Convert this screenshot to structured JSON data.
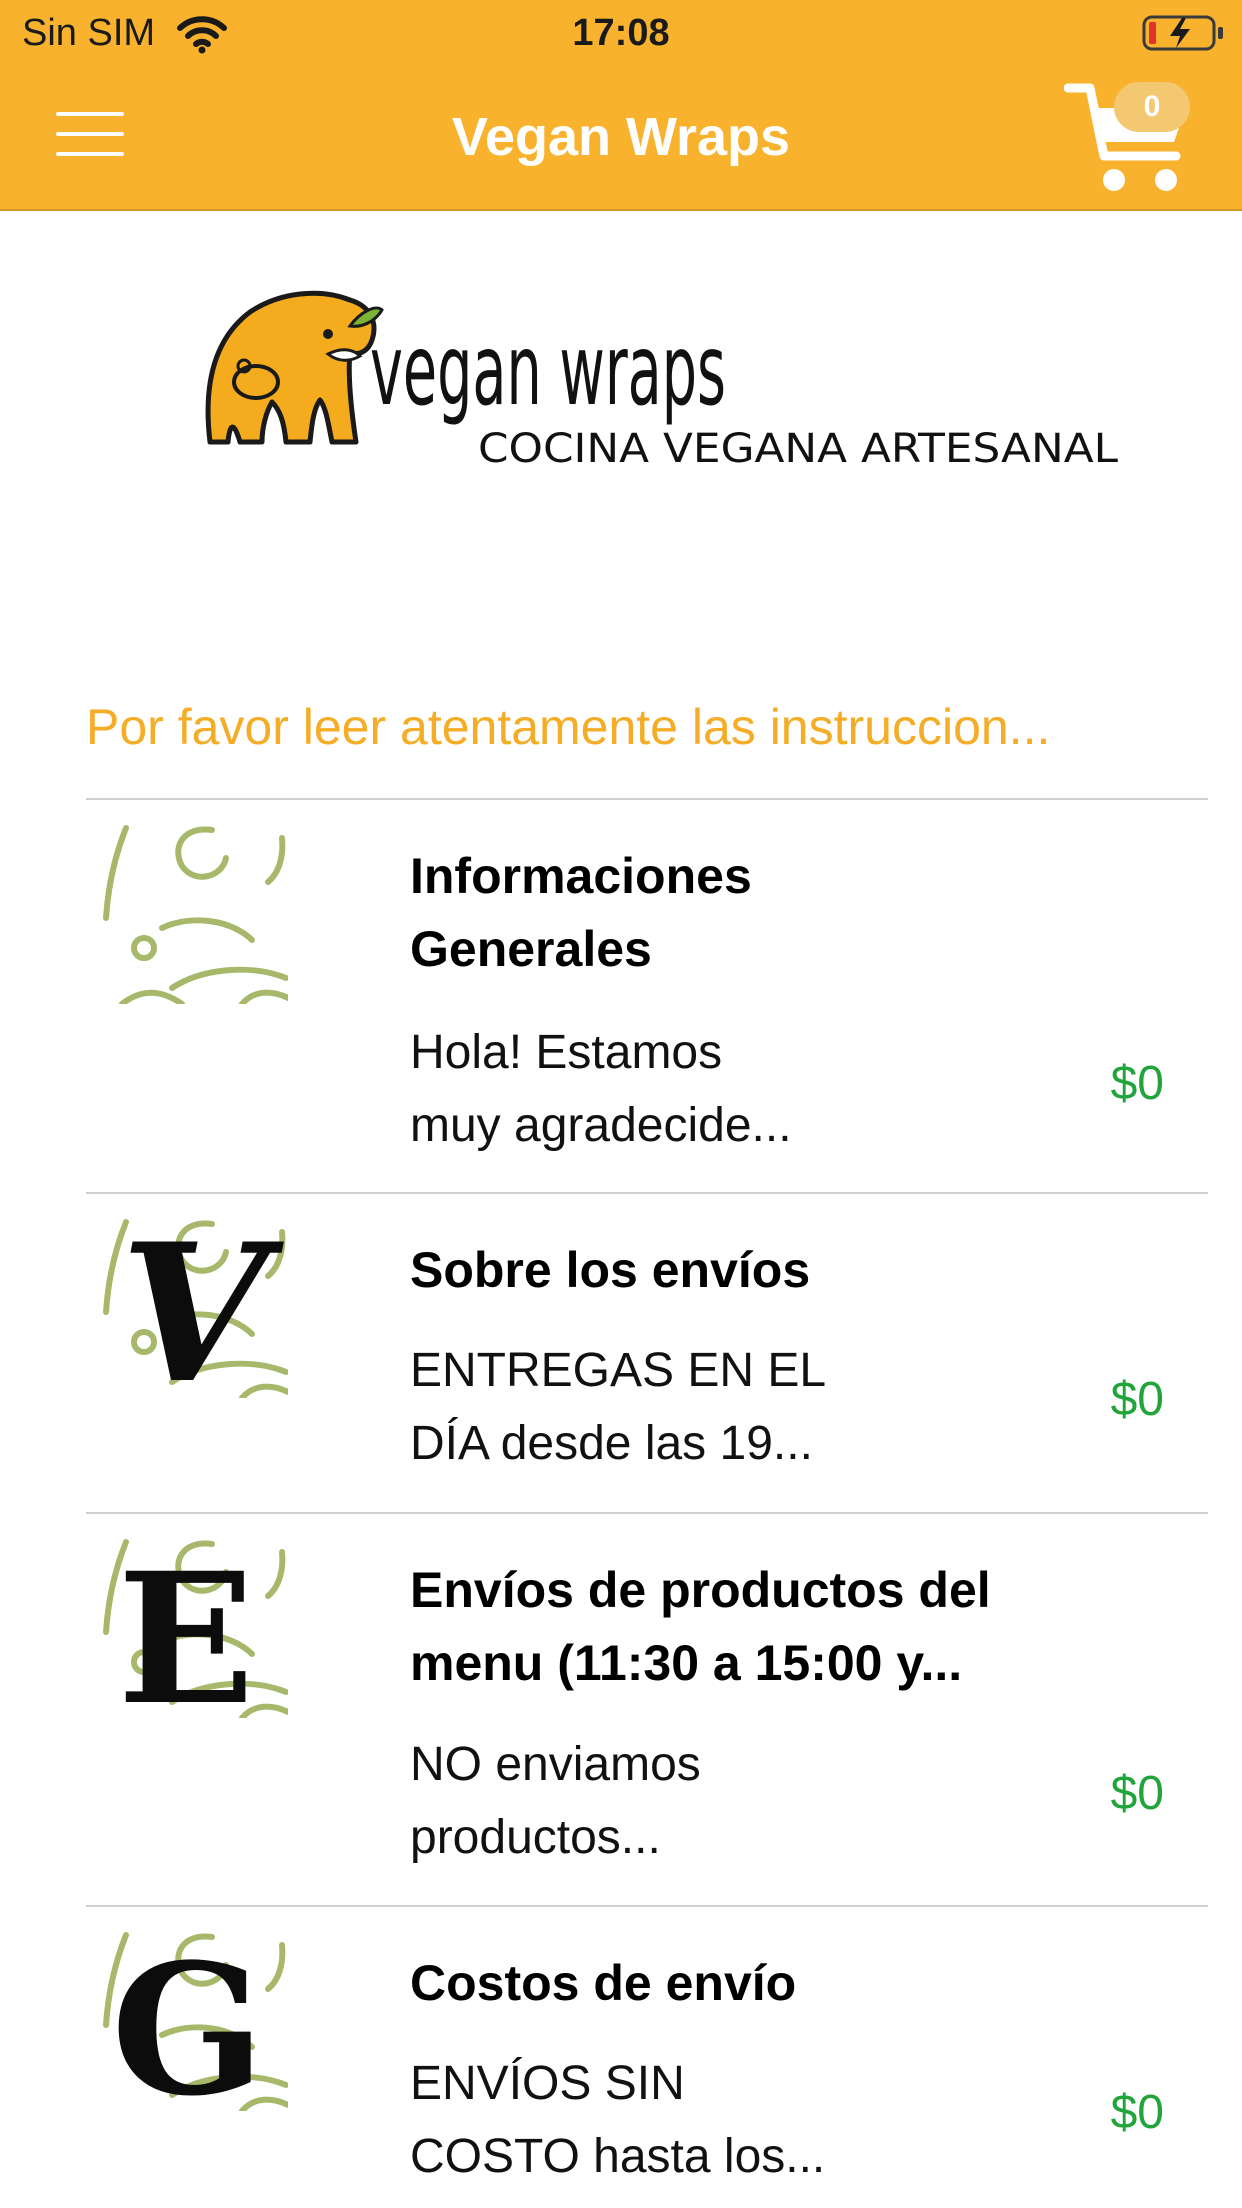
{
  "status_bar": {
    "carrier": "Sin SIM",
    "time": "17:08"
  },
  "nav": {
    "title": "Vegan Wraps",
    "cart_count": "0"
  },
  "logo": {
    "brand": "vegan wraps",
    "tagline": "COCINA VEGANA ARTESANAL"
  },
  "notice": "Por favor leer atentamente las instruccion...",
  "items": [
    {
      "title_lines": [
        "Informaciones",
        "Generales"
      ],
      "desc_lines": [
        "Hola! Estamos",
        "muy agradecide..."
      ],
      "price": "$0",
      "thumb_letter": ""
    },
    {
      "title_lines": [
        "Sobre los envíos"
      ],
      "desc_lines": [
        "ENTREGAS EN EL",
        "DÍA desde las 19..."
      ],
      "price": "$0",
      "thumb_letter": "V"
    },
    {
      "title_lines": [
        "Envíos de productos del",
        "menu (11:30 a 15:00 y..."
      ],
      "desc_lines": [
        "NO enviamos",
        "productos..."
      ],
      "price": "$0",
      "thumb_letter": "E"
    },
    {
      "title_lines": [
        "Costos de envío"
      ],
      "desc_lines": [
        "ENVÍOS SIN",
        "COSTO hasta los..."
      ],
      "price": "$0",
      "thumb_letter": "G"
    }
  ],
  "colors": {
    "header": "#f8b22d",
    "notice": "#f5ad27",
    "price": "#21a43a",
    "thumb_pattern": "#a8b86a"
  }
}
